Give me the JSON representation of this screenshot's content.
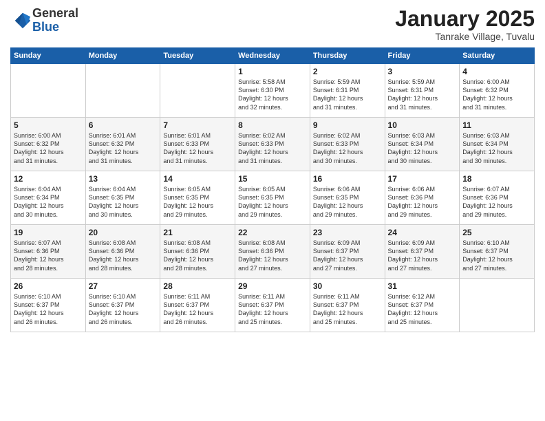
{
  "logo": {
    "general": "General",
    "blue": "Blue"
  },
  "header": {
    "month": "January 2025",
    "location": "Tanrake Village, Tuvalu"
  },
  "weekdays": [
    "Sunday",
    "Monday",
    "Tuesday",
    "Wednesday",
    "Thursday",
    "Friday",
    "Saturday"
  ],
  "weeks": [
    [
      {
        "day": "",
        "info": ""
      },
      {
        "day": "",
        "info": ""
      },
      {
        "day": "",
        "info": ""
      },
      {
        "day": "1",
        "info": "Sunrise: 5:58 AM\nSunset: 6:30 PM\nDaylight: 12 hours\nand 32 minutes."
      },
      {
        "day": "2",
        "info": "Sunrise: 5:59 AM\nSunset: 6:31 PM\nDaylight: 12 hours\nand 31 minutes."
      },
      {
        "day": "3",
        "info": "Sunrise: 5:59 AM\nSunset: 6:31 PM\nDaylight: 12 hours\nand 31 minutes."
      },
      {
        "day": "4",
        "info": "Sunrise: 6:00 AM\nSunset: 6:32 PM\nDaylight: 12 hours\nand 31 minutes."
      }
    ],
    [
      {
        "day": "5",
        "info": "Sunrise: 6:00 AM\nSunset: 6:32 PM\nDaylight: 12 hours\nand 31 minutes."
      },
      {
        "day": "6",
        "info": "Sunrise: 6:01 AM\nSunset: 6:32 PM\nDaylight: 12 hours\nand 31 minutes."
      },
      {
        "day": "7",
        "info": "Sunrise: 6:01 AM\nSunset: 6:33 PM\nDaylight: 12 hours\nand 31 minutes."
      },
      {
        "day": "8",
        "info": "Sunrise: 6:02 AM\nSunset: 6:33 PM\nDaylight: 12 hours\nand 31 minutes."
      },
      {
        "day": "9",
        "info": "Sunrise: 6:02 AM\nSunset: 6:33 PM\nDaylight: 12 hours\nand 30 minutes."
      },
      {
        "day": "10",
        "info": "Sunrise: 6:03 AM\nSunset: 6:34 PM\nDaylight: 12 hours\nand 30 minutes."
      },
      {
        "day": "11",
        "info": "Sunrise: 6:03 AM\nSunset: 6:34 PM\nDaylight: 12 hours\nand 30 minutes."
      }
    ],
    [
      {
        "day": "12",
        "info": "Sunrise: 6:04 AM\nSunset: 6:34 PM\nDaylight: 12 hours\nand 30 minutes."
      },
      {
        "day": "13",
        "info": "Sunrise: 6:04 AM\nSunset: 6:35 PM\nDaylight: 12 hours\nand 30 minutes."
      },
      {
        "day": "14",
        "info": "Sunrise: 6:05 AM\nSunset: 6:35 PM\nDaylight: 12 hours\nand 29 minutes."
      },
      {
        "day": "15",
        "info": "Sunrise: 6:05 AM\nSunset: 6:35 PM\nDaylight: 12 hours\nand 29 minutes."
      },
      {
        "day": "16",
        "info": "Sunrise: 6:06 AM\nSunset: 6:35 PM\nDaylight: 12 hours\nand 29 minutes."
      },
      {
        "day": "17",
        "info": "Sunrise: 6:06 AM\nSunset: 6:36 PM\nDaylight: 12 hours\nand 29 minutes."
      },
      {
        "day": "18",
        "info": "Sunrise: 6:07 AM\nSunset: 6:36 PM\nDaylight: 12 hours\nand 29 minutes."
      }
    ],
    [
      {
        "day": "19",
        "info": "Sunrise: 6:07 AM\nSunset: 6:36 PM\nDaylight: 12 hours\nand 28 minutes."
      },
      {
        "day": "20",
        "info": "Sunrise: 6:08 AM\nSunset: 6:36 PM\nDaylight: 12 hours\nand 28 minutes."
      },
      {
        "day": "21",
        "info": "Sunrise: 6:08 AM\nSunset: 6:36 PM\nDaylight: 12 hours\nand 28 minutes."
      },
      {
        "day": "22",
        "info": "Sunrise: 6:08 AM\nSunset: 6:36 PM\nDaylight: 12 hours\nand 27 minutes."
      },
      {
        "day": "23",
        "info": "Sunrise: 6:09 AM\nSunset: 6:37 PM\nDaylight: 12 hours\nand 27 minutes."
      },
      {
        "day": "24",
        "info": "Sunrise: 6:09 AM\nSunset: 6:37 PM\nDaylight: 12 hours\nand 27 minutes."
      },
      {
        "day": "25",
        "info": "Sunrise: 6:10 AM\nSunset: 6:37 PM\nDaylight: 12 hours\nand 27 minutes."
      }
    ],
    [
      {
        "day": "26",
        "info": "Sunrise: 6:10 AM\nSunset: 6:37 PM\nDaylight: 12 hours\nand 26 minutes."
      },
      {
        "day": "27",
        "info": "Sunrise: 6:10 AM\nSunset: 6:37 PM\nDaylight: 12 hours\nand 26 minutes."
      },
      {
        "day": "28",
        "info": "Sunrise: 6:11 AM\nSunset: 6:37 PM\nDaylight: 12 hours\nand 26 minutes."
      },
      {
        "day": "29",
        "info": "Sunrise: 6:11 AM\nSunset: 6:37 PM\nDaylight: 12 hours\nand 25 minutes."
      },
      {
        "day": "30",
        "info": "Sunrise: 6:11 AM\nSunset: 6:37 PM\nDaylight: 12 hours\nand 25 minutes."
      },
      {
        "day": "31",
        "info": "Sunrise: 6:12 AM\nSunset: 6:37 PM\nDaylight: 12 hours\nand 25 minutes."
      },
      {
        "day": "",
        "info": ""
      }
    ]
  ]
}
